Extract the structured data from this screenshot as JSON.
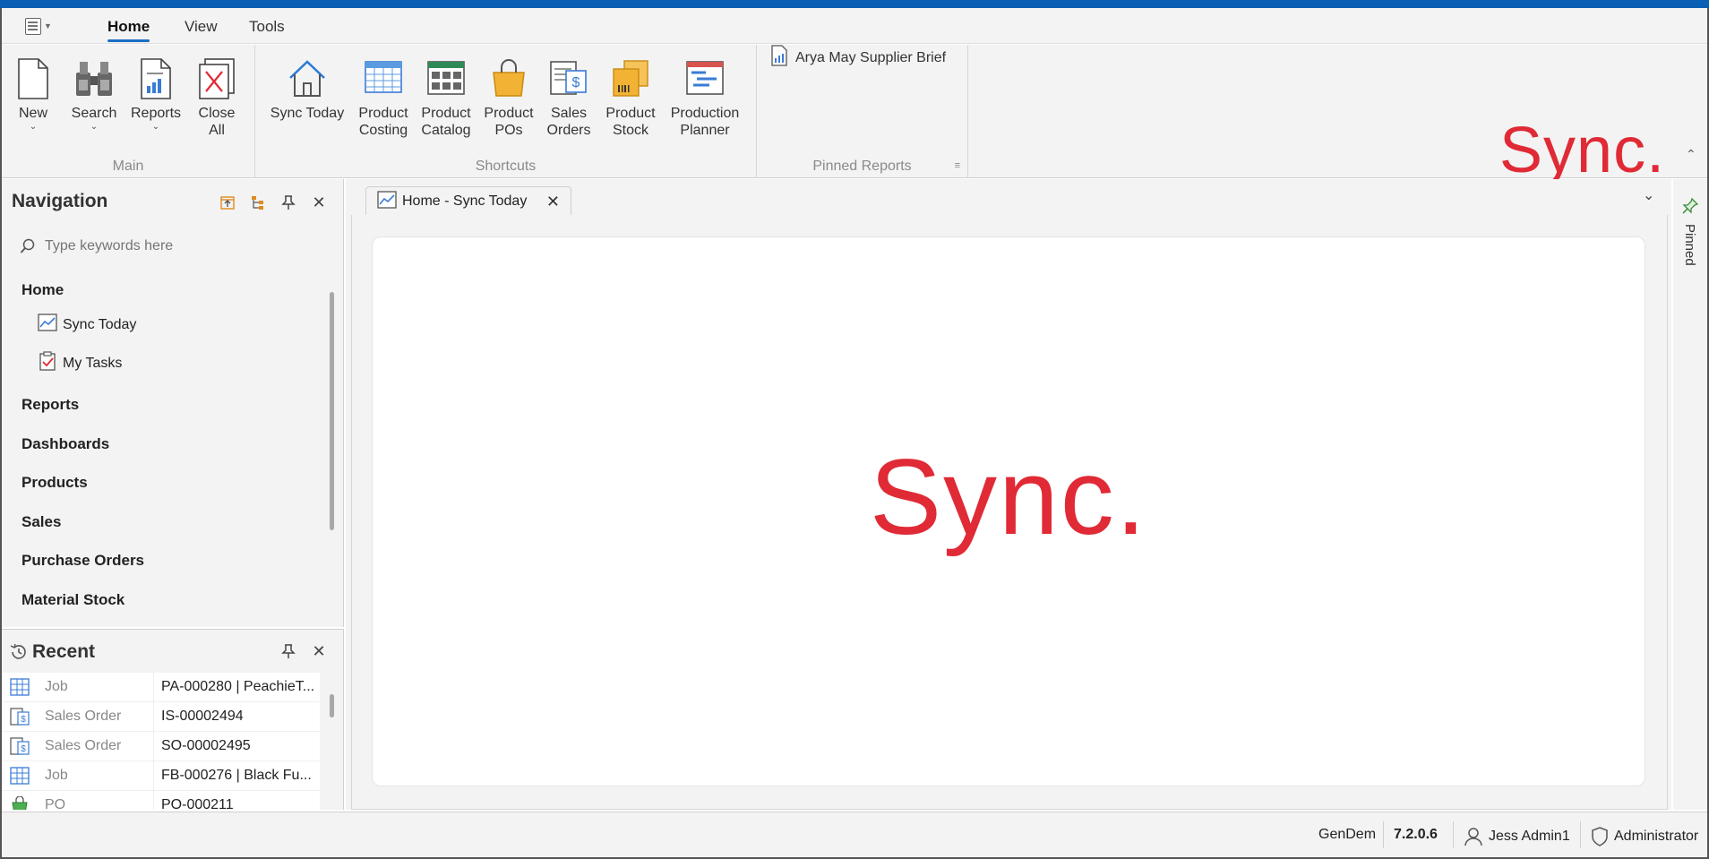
{
  "ribbon": {
    "tabs": [
      {
        "label": "Home",
        "active": true
      },
      {
        "label": "View",
        "active": false
      },
      {
        "label": "Tools",
        "active": false
      }
    ],
    "main_group": {
      "label": "Main",
      "buttons": {
        "new": "New",
        "search": "Search",
        "reports": "Reports",
        "close_all_1": "Close",
        "close_all_2": "All"
      }
    },
    "shortcuts_group": {
      "label": "Shortcuts",
      "buttons": {
        "sync_today": "Sync Today",
        "product_costing_1": "Product",
        "product_costing_2": "Costing",
        "product_catalog_1": "Product",
        "product_catalog_2": "Catalog",
        "product_pos_1": "Product",
        "product_pos_2": "POs",
        "sales_orders_1": "Sales",
        "sales_orders_2": "Orders",
        "product_stock_1": "Product",
        "product_stock_2": "Stock",
        "production_planner_1": "Production",
        "production_planner_2": "Planner"
      }
    },
    "pinned_reports_group": {
      "label": "Pinned Reports",
      "items": [
        "Arya May Supplier Brief"
      ]
    },
    "logo_text": "Sync."
  },
  "navigation": {
    "title": "Navigation",
    "search_placeholder": "Type keywords here",
    "sections": {
      "home": "Home",
      "sync_today": "Sync Today",
      "my_tasks": "My Tasks",
      "reports": "Reports",
      "dashboards": "Dashboards",
      "products": "Products",
      "sales": "Sales",
      "purchase_orders": "Purchase Orders",
      "material_stock": "Material Stock"
    }
  },
  "recent": {
    "title": "Recent",
    "rows": [
      {
        "type": "Job",
        "ref": "PA-000280 | PeachieT...",
        "icon": "job-icon"
      },
      {
        "type": "Sales Order",
        "ref": "IS-00002494",
        "icon": "sales-order-icon"
      },
      {
        "type": "Sales Order",
        "ref": "SO-00002495",
        "icon": "sales-order-icon"
      },
      {
        "type": "Job",
        "ref": "FB-000276 | Black Fu...",
        "icon": "job-icon"
      },
      {
        "type": "PO",
        "ref": "PO-000211",
        "icon": "po-icon"
      }
    ]
  },
  "document": {
    "tab_label": "Home - Sync Today",
    "center_logo": "Sync."
  },
  "pinned_side": {
    "label": "Pinned"
  },
  "status": {
    "database": "GenDem",
    "version": "7.2.0.6",
    "user": "Jess Admin1",
    "role": "Administrator"
  },
  "colors": {
    "accent": "#0a5fb5",
    "brand_red": "#e02a35"
  }
}
